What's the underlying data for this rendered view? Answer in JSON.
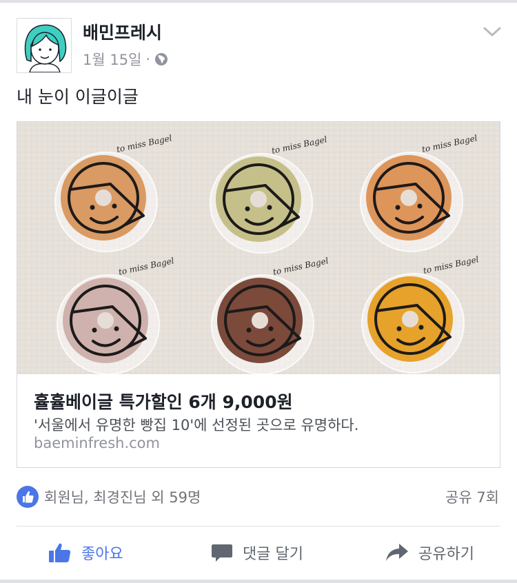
{
  "post": {
    "page_name": "배민프레시",
    "date": "1월 15일",
    "dot": "·",
    "message": "내 눈이 이글이글"
  },
  "link": {
    "title": "휼휼베이글 특가할인 6개 9,000원",
    "description": "'서울에서 유명한 빵집 10'에 선정된 곳으로 유명하다.",
    "domain": "baeminfresh.com"
  },
  "image": {
    "bagel_tags": [
      "to miss Bagel",
      "to miss Bagel",
      "to miss Bagel",
      "to miss Bagel",
      "to miss Bagel",
      "to miss Bagel"
    ]
  },
  "stats": {
    "reactions": "회원님, 최경진님 외 59명",
    "shares": "공유 7회"
  },
  "actions": {
    "like": "좋아요",
    "comment": "댓글 달기",
    "share": "공유하기"
  },
  "colors": {
    "accent": "#4a76e8",
    "text": "#1d2129",
    "muted": "#90949c"
  },
  "icons": [
    "globe-icon",
    "chevron-down-icon",
    "like-reaction-icon",
    "thumbs-up-icon",
    "comment-icon",
    "share-arrow-icon"
  ]
}
